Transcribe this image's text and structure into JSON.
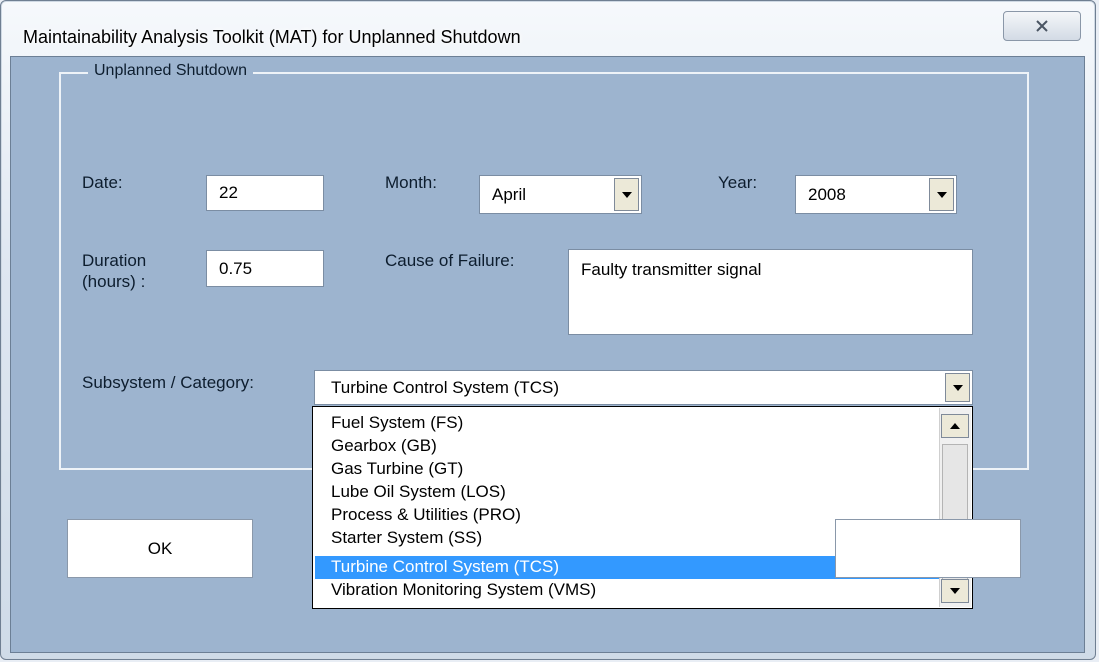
{
  "window": {
    "title": "Maintainability Analysis Toolkit (MAT) for Unplanned Shutdown",
    "close_icon": "close-icon"
  },
  "group": {
    "legend": "Unplanned Shutdown"
  },
  "form": {
    "date_label": "Date:",
    "date_value": "22",
    "month_label": "Month:",
    "month_value": "April",
    "year_label": "Year:",
    "year_value": "2008",
    "duration_label_line1": "Duration",
    "duration_label_line2": "(hours) :",
    "duration_value": "0.75",
    "cause_label": "Cause of Failure:",
    "cause_value": "Faulty transmitter signal",
    "subsystem_label": "Subsystem / Category:",
    "subsystem_value": "Turbine Control System (TCS)"
  },
  "subsystem_options": [
    "Fuel System (FS)",
    "Gearbox (GB)",
    "Gas Turbine (GT)",
    "Lube Oil System (LOS)",
    "Process & Utilities (PRO)",
    "Starter System (SS)",
    "Turbine Control System (TCS)",
    "Vibration Monitoring System (VMS)"
  ],
  "selected_option": "Turbine Control System (TCS)",
  "buttons": {
    "ok_label": "OK"
  },
  "colors": {
    "client_bg": "#9db4cf",
    "selection": "#3399ff"
  }
}
